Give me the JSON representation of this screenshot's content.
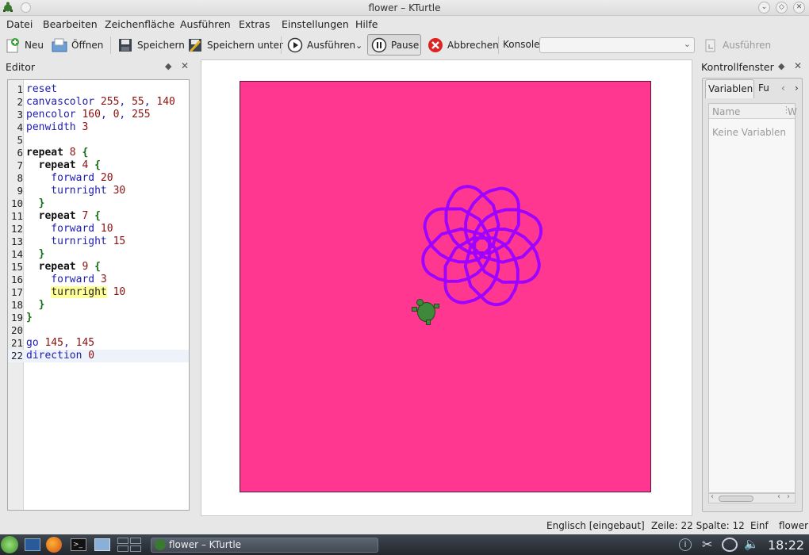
{
  "window": {
    "title": "flower – KTurtle"
  },
  "menu": [
    "Datei",
    "Bearbeiten",
    "Zeichenfläche",
    "Ausführen",
    "Extras",
    "Einstellungen",
    "Hilfe"
  ],
  "toolbar": {
    "new": "Neu",
    "open": "Öffnen",
    "save": "Speichern",
    "save_as": "Speichern unter",
    "run": "Ausführen",
    "pause": "Pause",
    "abort": "Abbrechen",
    "console_label": "Konsole",
    "console_run": "Ausführen"
  },
  "editor": {
    "title": "Editor",
    "lines": [
      {
        "n": "1",
        "parts": [
          [
            "cmd",
            "reset"
          ]
        ]
      },
      {
        "n": "2",
        "parts": [
          [
            "cmd",
            "canvascolor "
          ],
          [
            "num",
            "255"
          ],
          [
            "cmd",
            ", "
          ],
          [
            "num",
            "55"
          ],
          [
            "cmd",
            ", "
          ],
          [
            "num",
            "140"
          ]
        ]
      },
      {
        "n": "3",
        "parts": [
          [
            "cmd",
            "pencolor "
          ],
          [
            "num",
            "160"
          ],
          [
            "cmd",
            ", "
          ],
          [
            "num",
            "0"
          ],
          [
            "cmd",
            ", "
          ],
          [
            "num",
            "255"
          ]
        ]
      },
      {
        "n": "4",
        "parts": [
          [
            "cmd",
            "penwidth "
          ],
          [
            "num",
            "3"
          ]
        ]
      },
      {
        "n": "5",
        "parts": []
      },
      {
        "n": "6",
        "parts": [
          [
            "kw",
            "repeat "
          ],
          [
            "num",
            "8"
          ],
          [
            "br",
            " {"
          ]
        ]
      },
      {
        "n": "7",
        "parts": [
          [
            "cmd",
            "  "
          ],
          [
            "kw",
            "repeat "
          ],
          [
            "num",
            "4"
          ],
          [
            "br",
            " {"
          ]
        ]
      },
      {
        "n": "8",
        "parts": [
          [
            "cmd",
            "    forward "
          ],
          [
            "num",
            "20"
          ]
        ]
      },
      {
        "n": "9",
        "parts": [
          [
            "cmd",
            "    turnright "
          ],
          [
            "num",
            "30"
          ]
        ]
      },
      {
        "n": "10",
        "parts": [
          [
            "br",
            "  }"
          ]
        ]
      },
      {
        "n": "11",
        "parts": [
          [
            "cmd",
            "  "
          ],
          [
            "kw",
            "repeat "
          ],
          [
            "num",
            "7"
          ],
          [
            "br",
            " {"
          ]
        ]
      },
      {
        "n": "12",
        "parts": [
          [
            "cmd",
            "    forward "
          ],
          [
            "num",
            "10"
          ]
        ]
      },
      {
        "n": "13",
        "parts": [
          [
            "cmd",
            "    turnright "
          ],
          [
            "num",
            "15"
          ]
        ]
      },
      {
        "n": "14",
        "parts": [
          [
            "br",
            "  }"
          ]
        ]
      },
      {
        "n": "15",
        "parts": [
          [
            "cmd",
            "  "
          ],
          [
            "kw",
            "repeat "
          ],
          [
            "num",
            "9"
          ],
          [
            "br",
            " {"
          ]
        ]
      },
      {
        "n": "16",
        "parts": [
          [
            "cmd",
            "    forward "
          ],
          [
            "num",
            "3"
          ]
        ]
      },
      {
        "n": "17",
        "parts": [
          [
            "cmd",
            "    "
          ],
          [
            "hl",
            "turnright"
          ],
          [
            "cmd",
            " "
          ],
          [
            "num",
            "10"
          ]
        ]
      },
      {
        "n": "18",
        "parts": [
          [
            "br",
            "  }"
          ]
        ]
      },
      {
        "n": "19",
        "parts": [
          [
            "br",
            "}"
          ]
        ]
      },
      {
        "n": "20",
        "parts": []
      },
      {
        "n": "21",
        "parts": [
          [
            "cmd",
            "go "
          ],
          [
            "num",
            "145"
          ],
          [
            "cmd",
            ", "
          ],
          [
            "num",
            "145"
          ]
        ]
      },
      {
        "n": "22",
        "parts": [
          [
            "cmd",
            "direction "
          ],
          [
            "num",
            "0"
          ]
        ]
      }
    ]
  },
  "canvas": {
    "background": "#ff3790",
    "pen": "#a000ff"
  },
  "control": {
    "title": "Kontrollfenster",
    "tab_vars": "Variablen",
    "tab_fn": "Fu",
    "col_name": "Name",
    "col_w": "W",
    "empty": "Keine Variablen"
  },
  "status": {
    "language": "Englisch [eingebaut]",
    "position": "Zeile: 22 Spalte: 12",
    "mode": "Einf",
    "file": "flower"
  },
  "taskbar": {
    "task": "flower – KTurtle",
    "clock": "18:22"
  }
}
